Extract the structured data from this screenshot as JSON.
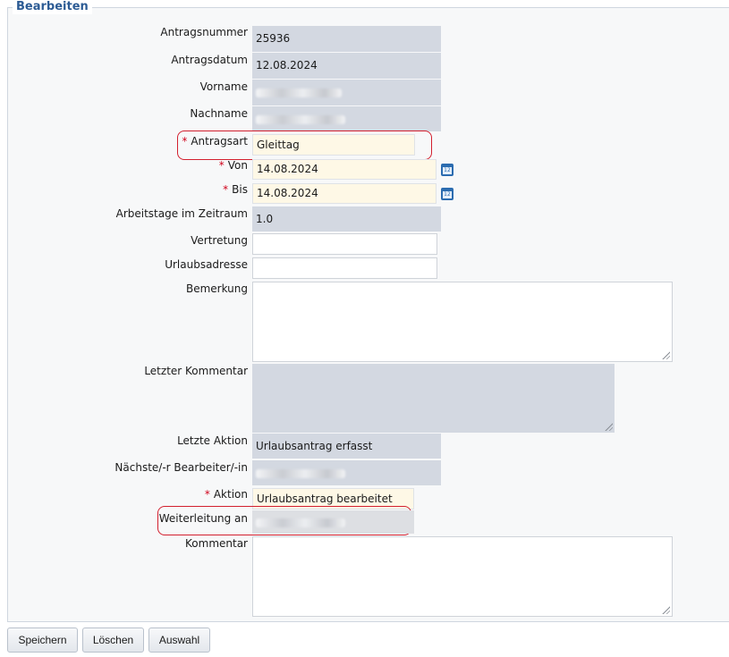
{
  "form": {
    "legend": "Bearbeiten",
    "fields": {
      "antragsnummer": {
        "label": "Antragsnummer",
        "value": "25936"
      },
      "antragsdatum": {
        "label": "Antragsdatum",
        "value": "12.08.2024"
      },
      "vorname": {
        "label": "Vorname"
      },
      "nachname": {
        "label": "Nachname"
      },
      "antragsart": {
        "label": "Antragsart",
        "value": "Gleittag",
        "required": true
      },
      "von": {
        "label": "Von",
        "value": "14.08.2024",
        "required": true
      },
      "bis": {
        "label": "Bis",
        "value": "14.08.2024",
        "required": true
      },
      "arbeitstage": {
        "label": "Arbeitstage im Zeitraum",
        "value": "1.0"
      },
      "vertretung": {
        "label": "Vertretung",
        "value": ""
      },
      "urlaubsadresse": {
        "label": "Urlaubsadresse",
        "value": ""
      },
      "bemerkung": {
        "label": "Bemerkung",
        "value": ""
      },
      "letzter_kommentar": {
        "label": "Letzter Kommentar",
        "value": ""
      },
      "letzte_aktion": {
        "label": "Letzte Aktion",
        "value": "Urlaubsantrag erfasst"
      },
      "naechste_bearbeiter": {
        "label": "Nächste/-r Bearbeiter/-in"
      },
      "aktion": {
        "label": "Aktion",
        "value": "Urlaubsantrag bearbeitet",
        "required": true
      },
      "weiterleitung": {
        "label": "Weiterleitung an"
      },
      "kommentar": {
        "label": "Kommentar",
        "value": ""
      }
    },
    "required_marker": "*",
    "calendar_icon_text": "12"
  },
  "buttons": {
    "save": "Speichern",
    "delete": "Löschen",
    "select": "Auswahl"
  },
  "colors": {
    "legend": "#2c5b94",
    "required": "#d0021b",
    "readonly_bg": "#d3d8e1",
    "editable_bg": "#fef8e6",
    "highlight": "#d3202f",
    "calendar": "#2b6cb0"
  }
}
